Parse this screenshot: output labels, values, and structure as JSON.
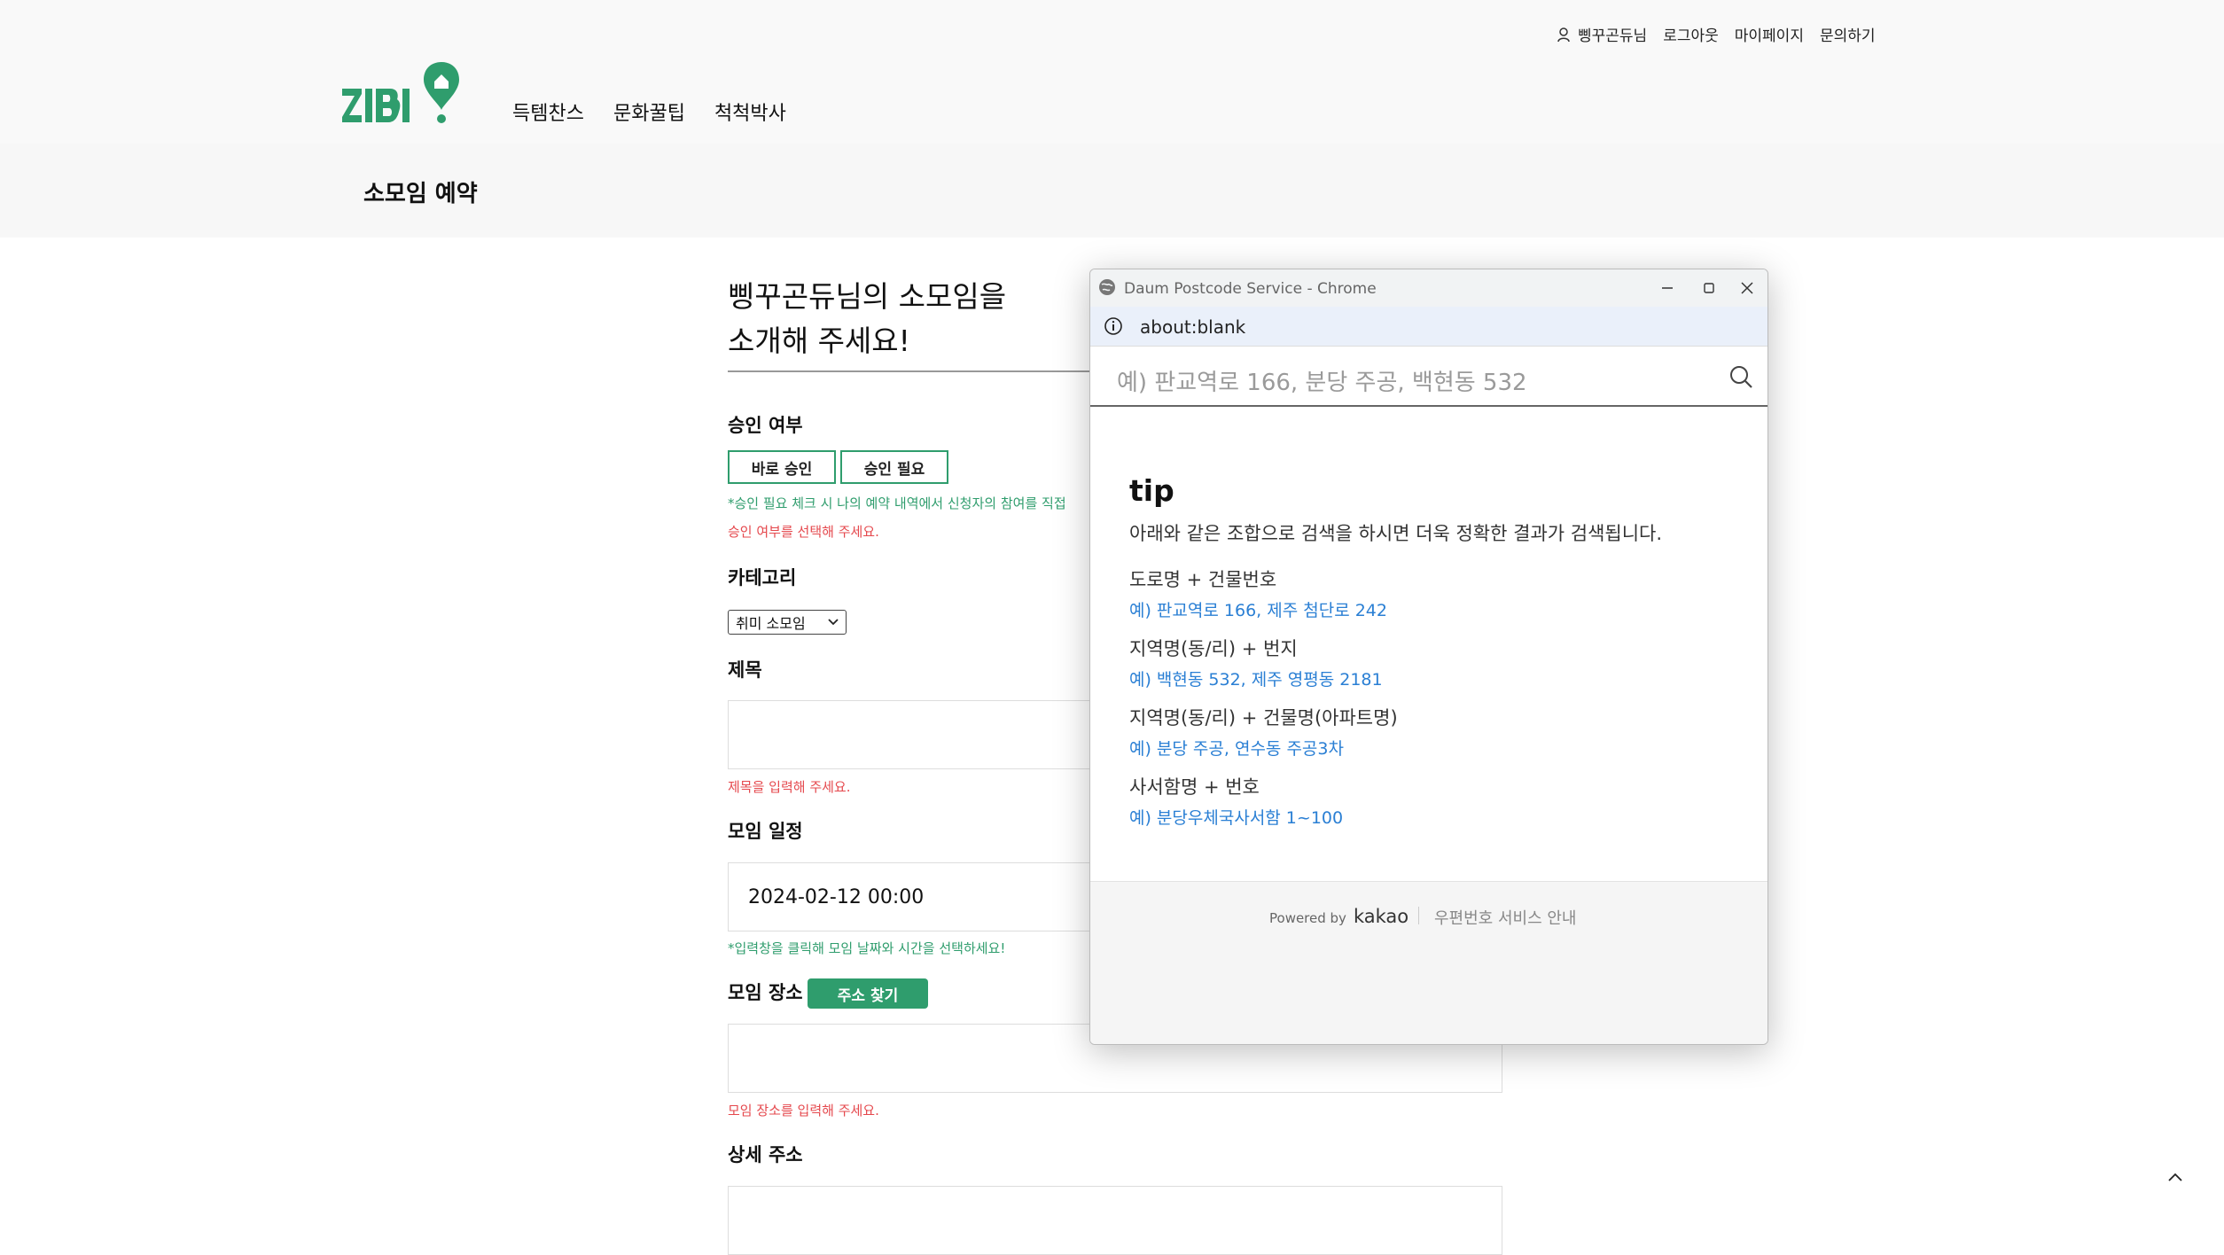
{
  "header": {
    "user_name": "삥꾸곤듀님",
    "logout": "로그아웃",
    "mypage": "마이페이지",
    "inquiry": "문의하기",
    "nav": [
      "득템찬스",
      "문화꿀팁",
      "척척박사"
    ],
    "page_title": "소모임 예약"
  },
  "form": {
    "intro_line1": "삥꾸곤듀님의 소모임을",
    "intro_line2": "소개해 주세요!",
    "approval": {
      "label": "승인 여부",
      "instant": "바로 승인",
      "required": "승인 필요",
      "hint": "*승인 필요 체크 시 나의 예약 내역에서 신청자의 참여를 직접",
      "error": "승인 여부를 선택해 주세요."
    },
    "category": {
      "label": "카테고리",
      "selected": "취미 소모임"
    },
    "title": {
      "label": "제목",
      "value": "",
      "error": "제목을 입력해 주세요."
    },
    "schedule": {
      "label": "모임 일정",
      "value": "2024-02-12 00:00",
      "hint": "*입력창을 클릭해 모임 날짜와 시간을 선택하세요!"
    },
    "place": {
      "label": "모임 장소",
      "find_button": "주소 찾기",
      "value": "",
      "error": "모임 장소를 입력해 주세요."
    },
    "detail_address": {
      "label": "상세 주소"
    }
  },
  "popup": {
    "window_title": "Daum Postcode Service - Chrome",
    "url": "about:blank",
    "search_placeholder": "예) 판교역로 166, 분당 주공, 백현동 532",
    "tip_heading": "tip",
    "tip_desc": "아래와 같은 조합으로 검색을 하시면 더욱 정확한 결과가 검색됩니다.",
    "examples": [
      {
        "title": "도로명 + 건물번호",
        "value": "예) 판교역로 166,  제주 첨단로 242"
      },
      {
        "title": "지역명(동/리) + 번지",
        "value": "예) 백현동 532,  제주 영평동 2181"
      },
      {
        "title": "지역명(동/리) + 건물명(아파트명)",
        "value": "예) 분당 주공,  연수동 주공3차"
      },
      {
        "title": "사서함명 + 번호",
        "value": "예) 분당우체국사서함 1~100"
      }
    ],
    "powered_by": "Powered by",
    "brand": "kakao",
    "service_info": "우편번호 서비스 안내"
  },
  "colors": {
    "accent": "#2f9d6d",
    "error": "#e5484d",
    "link": "#2a7fd4"
  },
  "icons": [
    "user-icon",
    "globe-icon",
    "minimize-icon",
    "maximize-icon",
    "close-icon",
    "info-icon",
    "search-icon",
    "chevron-down-icon",
    "chevron-up-icon"
  ]
}
